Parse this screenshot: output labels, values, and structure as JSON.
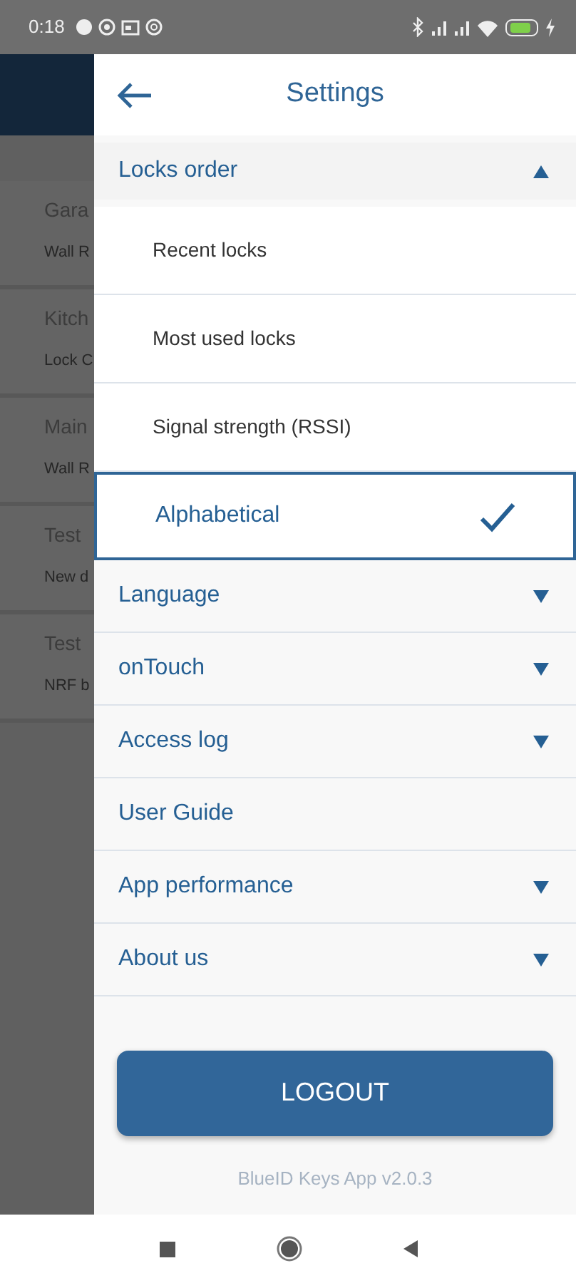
{
  "status_bar": {
    "time": "0:18"
  },
  "background_list": [
    {
      "title": "Gara",
      "subtitle": "Wall R"
    },
    {
      "title": "Kitch",
      "subtitle": "Lock C"
    },
    {
      "title": "Main",
      "subtitle": "Wall R"
    },
    {
      "title": "Test",
      "subtitle": "New d"
    },
    {
      "title": "Test",
      "subtitle": "NRF b"
    }
  ],
  "drawer": {
    "title": "Settings",
    "sections": [
      {
        "label": "Locks order",
        "kind": "expandable",
        "expanded": true,
        "options": [
          {
            "label": "Recent locks",
            "selected": false
          },
          {
            "label": "Most used locks",
            "selected": false
          },
          {
            "label": "Signal strength (RSSI)",
            "selected": false
          },
          {
            "label": "Alphabetical",
            "selected": true
          }
        ]
      },
      {
        "label": "Language",
        "kind": "expandable",
        "expanded": false
      },
      {
        "label": "onTouch",
        "kind": "expandable",
        "expanded": false
      },
      {
        "label": "Access log",
        "kind": "expandable",
        "expanded": false
      },
      {
        "label": "User Guide",
        "kind": "link"
      },
      {
        "label": "App performance",
        "kind": "expandable",
        "expanded": false
      },
      {
        "label": "About us",
        "kind": "expandable",
        "expanded": false
      }
    ],
    "logout": "LOGOUT",
    "version": "BlueID Keys App v2.0.3"
  }
}
